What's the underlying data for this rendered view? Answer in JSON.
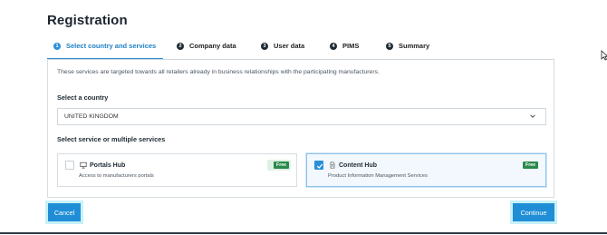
{
  "page": {
    "title": "Registration"
  },
  "steps": [
    {
      "number": "1",
      "label": "Select country and services",
      "active": true
    },
    {
      "number": "2",
      "label": "Company data",
      "active": false
    },
    {
      "number": "3",
      "label": "User data",
      "active": false
    },
    {
      "number": "4",
      "label": "PIMS",
      "active": false
    },
    {
      "number": "5",
      "label": "Summary",
      "active": false
    }
  ],
  "intro_text": "These services are targeted towards all retailers already in business relationships with the participating manufacturers.",
  "country": {
    "label": "Select a country",
    "selected": "UNITED KINGDOM"
  },
  "services": {
    "label": "Select service or multiple services",
    "items": [
      {
        "title": "Portals Hub",
        "subtitle": "Access to manufacturers portals",
        "badge": "Free",
        "checked": false,
        "icon": "monitor-icon"
      },
      {
        "title": "Content Hub",
        "subtitle": "Product Information Management Services",
        "badge": "Free",
        "checked": true,
        "icon": "document-icon"
      }
    ]
  },
  "actions": {
    "cancel_label": "Cancel",
    "continue_label": "Continue"
  },
  "colors": {
    "accent": "#1f8ed6",
    "badge": "#2a8a4a",
    "dark": "#1e2a33"
  }
}
